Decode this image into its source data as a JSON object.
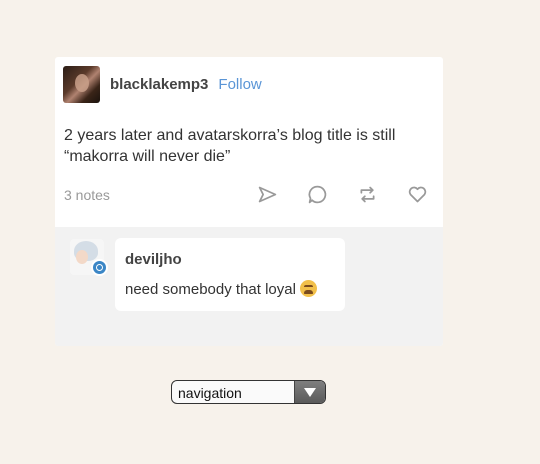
{
  "post": {
    "username": "blacklakemp3",
    "follow_label": "Follow",
    "body": "2 years later and avatarskorra’s blog title is still “makorra will never die”",
    "notes": "3 notes",
    "actions": [
      "share-icon",
      "reply-icon",
      "reblog-icon",
      "like-icon"
    ]
  },
  "reply": {
    "username": "deviljho",
    "text": "need somebody that loyal",
    "emoji": "weary-face"
  },
  "navigation": {
    "selected": "navigation"
  },
  "colors": {
    "background": "#f7f2eb",
    "follow": "#5a95d6",
    "reply_area": "#f2f2f2"
  }
}
